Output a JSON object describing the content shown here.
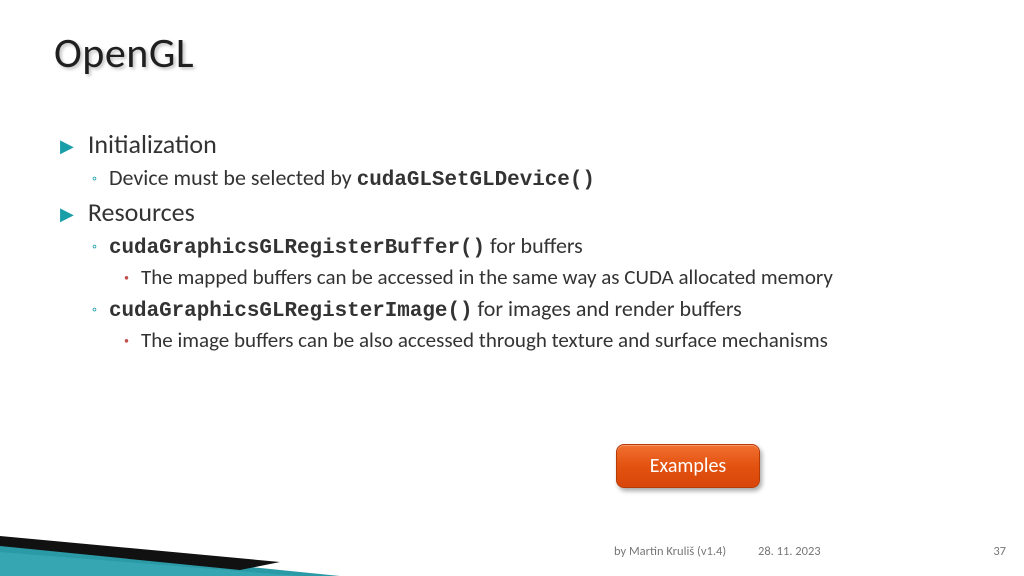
{
  "title": "OpenGL",
  "bullets": {
    "init": "Initialization",
    "init_sub_pre": "Device must be selected by ",
    "init_sub_code": "cudaGLSetGLDevice()",
    "res": "Resources",
    "res_buf_code": "cudaGraphicsGLRegisterBuffer()",
    "res_buf_post": " for buffers",
    "res_buf_detail": "The mapped buffers can be accessed in the same way as CUDA allocated memory",
    "res_img_code": "cudaGraphicsGLRegisterImage()",
    "res_img_post": " for images and render buffers",
    "res_img_detail": "The image buffers can be also accessed through texture and surface mechanisms"
  },
  "button": {
    "examples": "Examples"
  },
  "footer": {
    "author": "by Martin Kruliš (v1.4)",
    "date": "28. 11. 2023",
    "page": "37"
  }
}
